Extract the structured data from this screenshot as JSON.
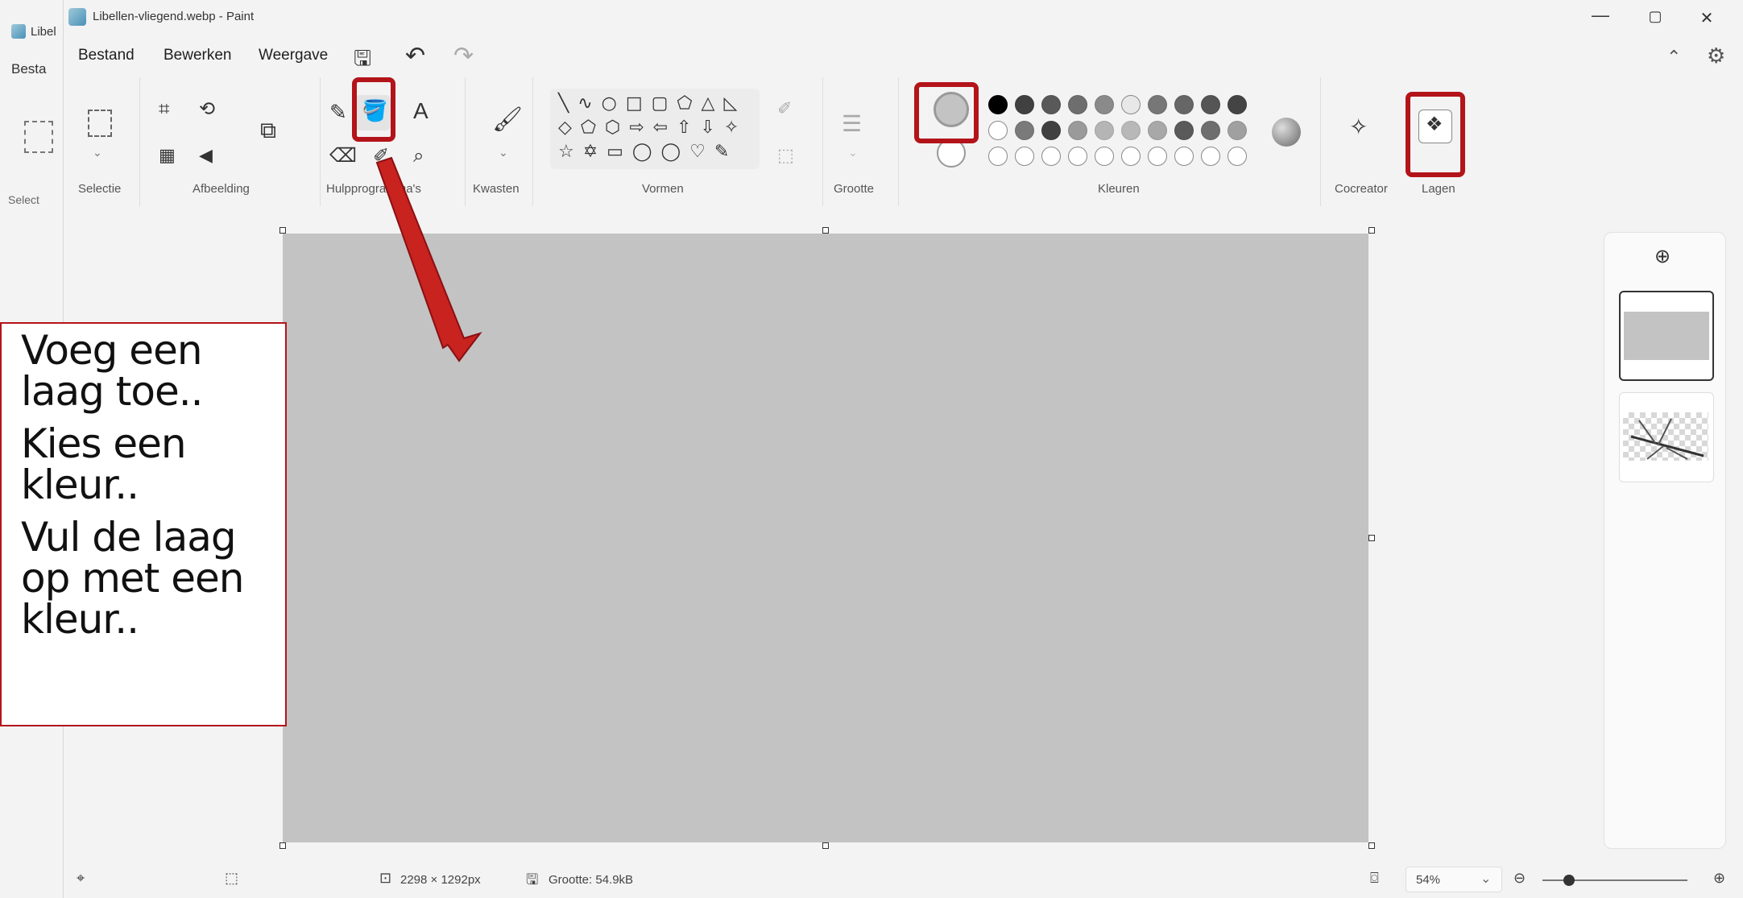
{
  "background_window": {
    "title": "Libel",
    "menu": "Besta",
    "select_label": "Select"
  },
  "window": {
    "title": "Libellen-vliegend.webp - Paint",
    "controls": {
      "minimize": "—",
      "maximize": "▢",
      "close": "✕"
    }
  },
  "menu": {
    "bestand": "Bestand",
    "bewerken": "Bewerken",
    "weergave": "Weergave"
  },
  "ribbon": {
    "groups": {
      "selectie": "Selectie",
      "afbeelding": "Afbeelding",
      "hulpprogrammas": "Hulpprogramma's",
      "kwasten": "Kwasten",
      "vormen": "Vormen",
      "grootte": "Grootte",
      "kleuren": "Kleuren",
      "cocreator": "Cocreator",
      "lagen": "Lagen"
    },
    "shapes_row1": "╲ ∿ ○ □ ▢ ⬠ △ ◺",
    "shapes_row2": "◇ ⬠ ⬡ ⇨ ⇦ ⇧ ⇩ ✧",
    "shapes_row3": "☆ ✡ ▭ ◯ ◯ ♡ ✎",
    "colors": {
      "accent": "#b3141a",
      "canvas": "#c3c3c3",
      "row1": [
        "#000000",
        "#404040",
        "#595959",
        "#6e6e6e",
        "#8a8a8a",
        "#e8e8e8",
        "#777777",
        "#666666",
        "#555555",
        "#444444"
      ],
      "row2": [
        "#ffffff",
        "#7a7a7a",
        "#404040",
        "#9a9a9a",
        "#b5b5b5",
        "#b8b8b8",
        "#a8a8a8",
        "#5a5a5a",
        "#6e6e6e",
        "#a0a0a0"
      ],
      "row3": [
        "#ffffff",
        "#ffffff",
        "#ffffff",
        "#ffffff",
        "#ffffff",
        "#ffffff",
        "#ffffff",
        "#ffffff",
        "#ffffff",
        "#ffffff"
      ]
    }
  },
  "status": {
    "dimensions": "2298 × 1292px",
    "size": "Grootte: 54.9kB",
    "zoom": "54%"
  },
  "callout": {
    "line1": "Voeg een laag toe..",
    "line2": "Kies een kleur..",
    "line3": "Vul de laag op met een kleur.."
  }
}
